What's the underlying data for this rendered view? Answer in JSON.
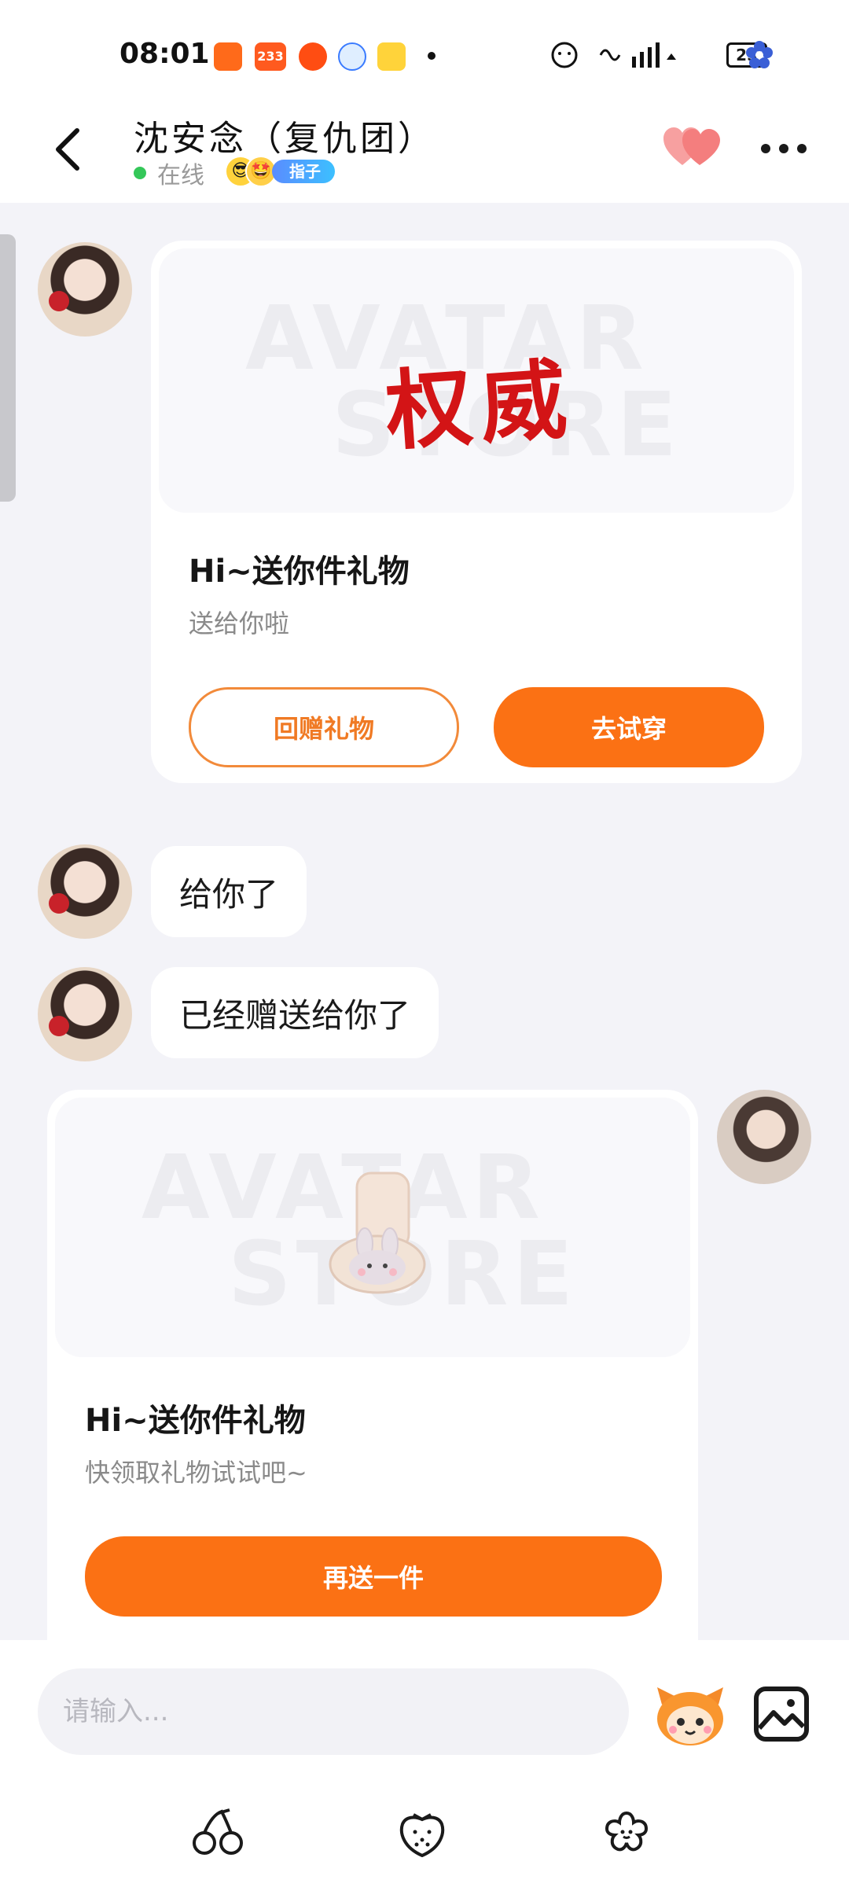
{
  "status_bar": {
    "time": "08:01",
    "app_badge_233": "233",
    "battery": "25"
  },
  "header": {
    "title": "沈安念（复仇团）",
    "status": "在线",
    "badge_tag": "指子"
  },
  "messages": {
    "gift_card_1": {
      "image_text": "权威",
      "watermark_line1": "AVATAR",
      "watermark_line2": "STORE",
      "title": "Hi~送你件礼物",
      "subtitle": "送给你啦",
      "button_left": "回赠礼物",
      "button_right": "去试穿"
    },
    "bubble_1": "给你了",
    "bubble_2": "已经赠送给你了",
    "gift_card_2": {
      "watermark_line1": "AVATAR",
      "watermark_line2": "STORE",
      "title": "Hi~送你件礼物",
      "subtitle": "快领取礼物试试吧~",
      "button": "再送一件"
    }
  },
  "input": {
    "placeholder": "请输入..."
  },
  "icons": {
    "back": "back-arrow-icon",
    "hearts": "hearts-icon",
    "more": "more-icon",
    "mascot": "mascot-emoji-icon",
    "image": "image-icon",
    "cherry": "cherry-icon",
    "strawberry": "strawberry-icon",
    "flower": "flower-icon"
  },
  "colors": {
    "accent": "#fb7114",
    "outline": "#f28a3a",
    "online": "#34c759"
  }
}
